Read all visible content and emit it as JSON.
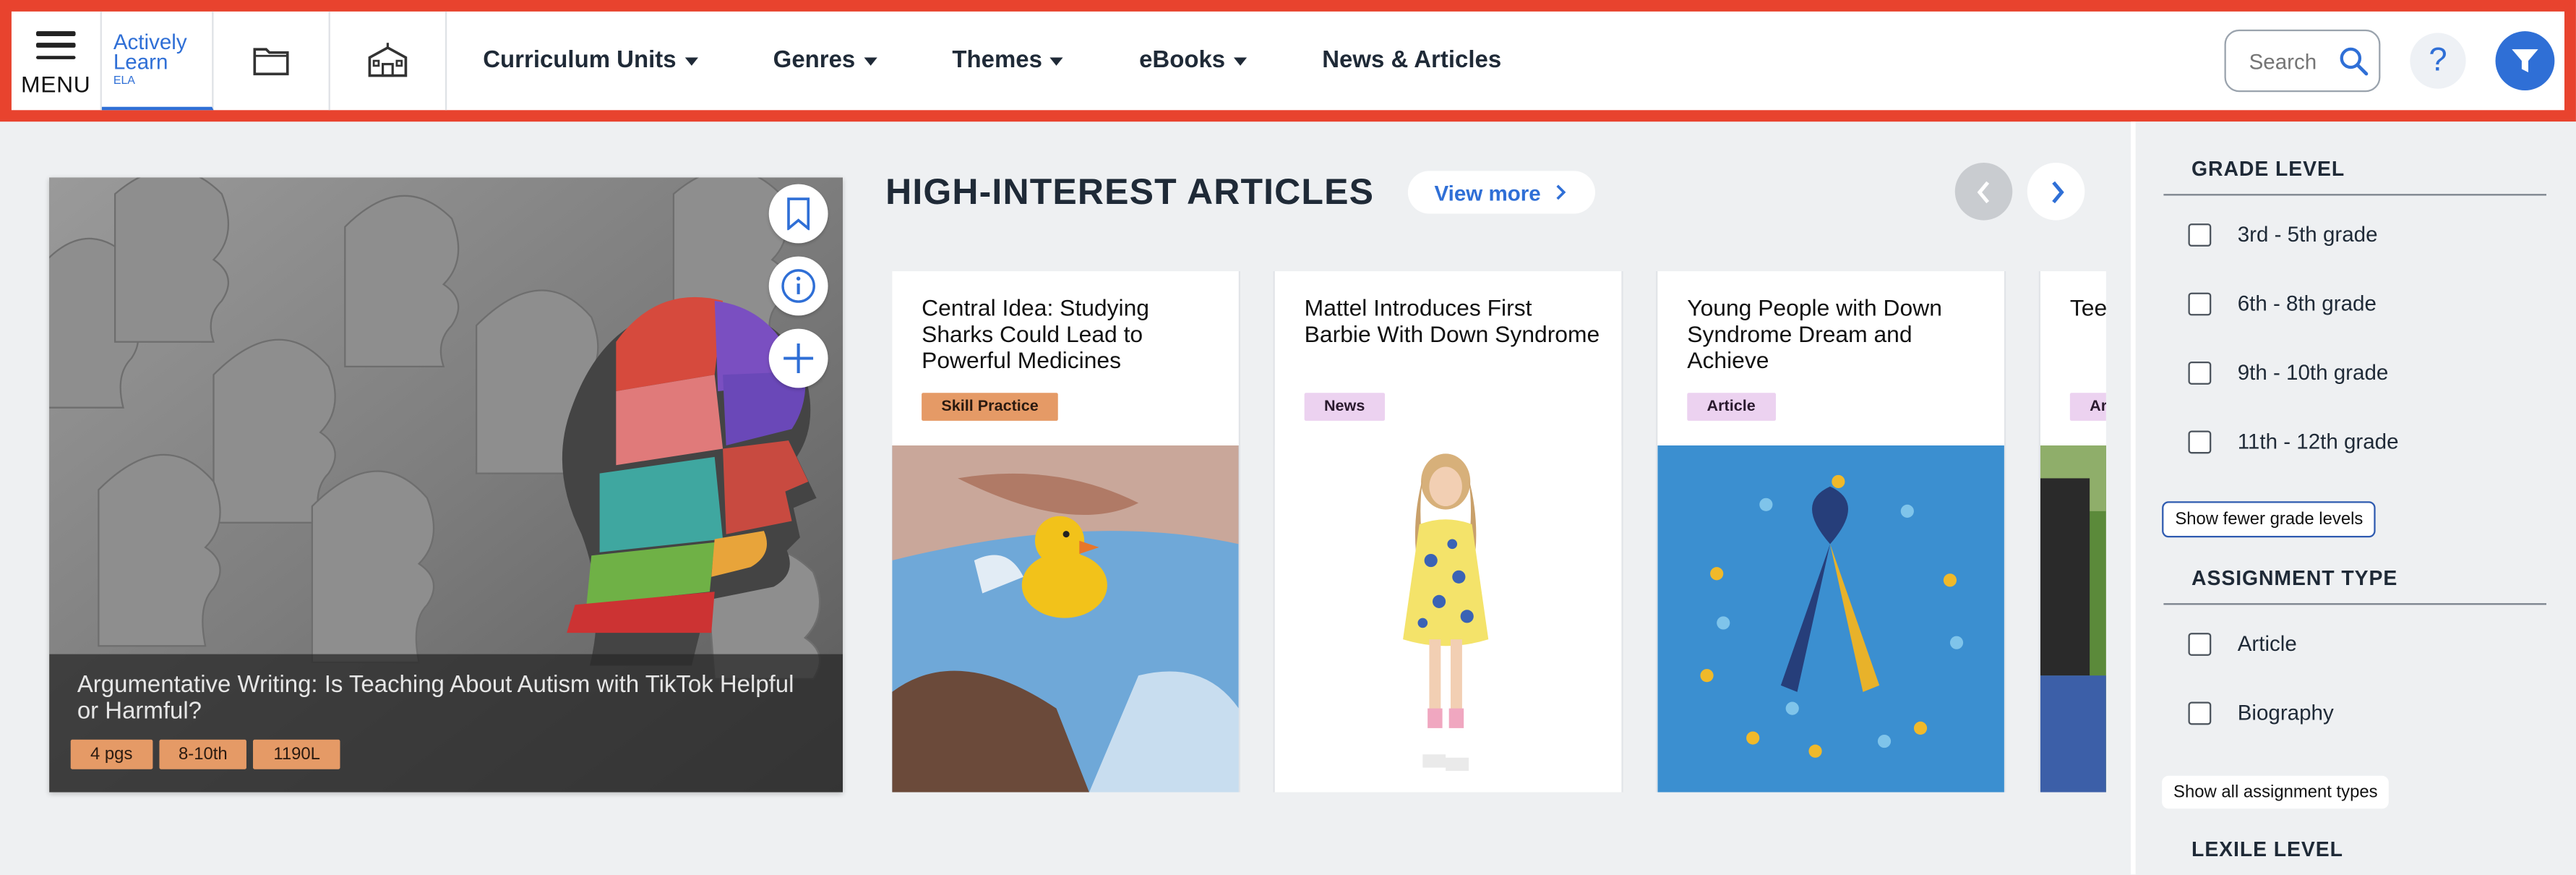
{
  "header": {
    "menu_label": "MENU",
    "logo": {
      "line1": "Actively",
      "line2": "Learn",
      "line3": "ELA"
    },
    "icons": [
      "folder-icon",
      "school-icon"
    ],
    "nav": [
      {
        "label": "Curriculum Units",
        "dropdown": true
      },
      {
        "label": "Genres",
        "dropdown": true
      },
      {
        "label": "Themes",
        "dropdown": true
      },
      {
        "label": "eBooks",
        "dropdown": true
      },
      {
        "label": "News & Articles",
        "dropdown": false
      }
    ],
    "search_placeholder": "Search",
    "help_label": "?",
    "accent": "#2f6fd6",
    "frame_color": "#e8432e"
  },
  "featured": {
    "title": "Argumentative Writing: Is Teaching About Autism with TikTok Helpful or Harmful?",
    "tags": [
      "4 pgs",
      "8-10th",
      "1190L"
    ],
    "actions": [
      "bookmark-icon",
      "info-icon",
      "plus-icon"
    ]
  },
  "section": {
    "title": "HIGH-INTEREST ARTICLES",
    "view_more": "View more"
  },
  "cards": [
    {
      "title": "Central Idea: Studying Sharks Could Lead to Powerful Medicines",
      "badge": "Skill Practice",
      "badge_color": "#e59a66"
    },
    {
      "title": "Mattel Introduces First Barbie With Down Syndrome",
      "badge": "News",
      "badge_color": "#ecd2f0"
    },
    {
      "title": "Young People with Down Syndrome Dream and Achieve",
      "badge": "Article",
      "badge_color": "#ecd2f0"
    },
    {
      "title": "Tee Wis Cor",
      "badge": "Ar",
      "badge_color": "#ecd2f0"
    }
  ],
  "filters": {
    "grade": {
      "heading": "GRADE LEVEL",
      "options": [
        "3rd - 5th grade",
        "6th - 8th grade",
        "9th - 10th grade",
        "11th - 12th grade"
      ],
      "toggle": "Show fewer grade levels"
    },
    "assignment": {
      "heading": "ASSIGNMENT TYPE",
      "options": [
        "Article",
        "Biography"
      ],
      "toggle": "Show all assignment types"
    },
    "lexile": {
      "heading": "LEXILE LEVEL"
    }
  }
}
